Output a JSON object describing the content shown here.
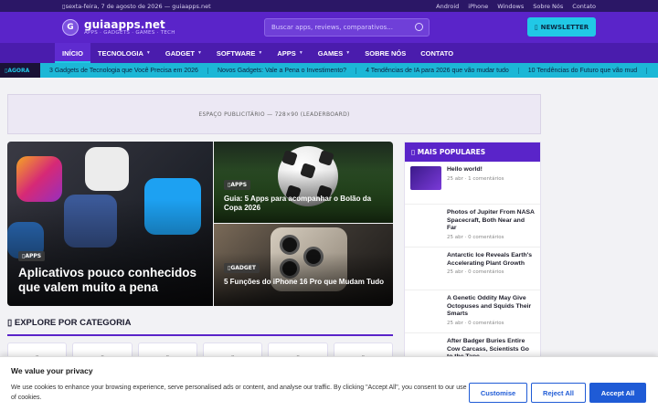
{
  "topbar": {
    "date": "sexta-feira, 7 de agosto de 2026 — guiaapps.net",
    "links": [
      "Android",
      "iPhone",
      "Windows",
      "Sobre Nós",
      "Contato"
    ]
  },
  "header": {
    "logo_letter": "G",
    "site_name": "guiaapps.net",
    "tagline": "APPS · GADGETS · GAMES · TECH",
    "search_placeholder": "Buscar apps, reviews, comparativos...",
    "newsletter_label": "NEWSLETTER"
  },
  "nav": [
    {
      "label": "INÍCIO",
      "active": true,
      "dropdown": false
    },
    {
      "label": "TECNOLOGIA",
      "active": false,
      "dropdown": true
    },
    {
      "label": "GADGET",
      "active": false,
      "dropdown": true
    },
    {
      "label": "SOFTWARE",
      "active": false,
      "dropdown": true
    },
    {
      "label": "APPS",
      "active": false,
      "dropdown": true
    },
    {
      "label": "GAMES",
      "active": false,
      "dropdown": true
    },
    {
      "label": "SOBRE NÓS",
      "active": false,
      "dropdown": false
    },
    {
      "label": "CONTATO",
      "active": false,
      "dropdown": false
    }
  ],
  "ticker": {
    "label": "AGORA",
    "items": [
      "3 Gadgets de Tecnologia que Você Precisa em 2026",
      "Novos Gadgets: Vale a Pena o Investimento?",
      "4 Tendências de IA para 2026 que vão mudar tudo",
      "10 Tendências do Futuro que vão mud"
    ]
  },
  "ad": {
    "label": "ESPAÇO PUBLICITÁRIO — 728×90 (LEADERBOARD)"
  },
  "hero": {
    "main": {
      "badge": "APPS",
      "title": "Aplicativos pouco conhecidos que valem muito a pena"
    },
    "top_right": {
      "badge": "APPS",
      "title": "Guia: 5 Apps para acompanhar o Bolão da Copa 2026"
    },
    "bottom_right": {
      "badge": "GADGET",
      "title": "5 Funções do iPhone 16 Pro que Mudam Tudo"
    }
  },
  "section": {
    "explore_title": "EXPLORE POR CATEGORIA"
  },
  "sidebar": {
    "title": "MAIS POPULARES",
    "items": [
      {
        "title": "Hello world!",
        "meta": "25 abr · 1 comentários"
      },
      {
        "title": "Photos of Jupiter From NASA Spacecraft, Both Near and Far",
        "meta": "25 abr · 0 comentários"
      },
      {
        "title": "Antarctic Ice Reveals Earth's Accelerating Plant Growth",
        "meta": "25 abr · 0 comentários"
      },
      {
        "title": "A Genetic Oddity May Give Octopuses and Squids Their Smarts",
        "meta": "25 abr · 0 comentários"
      },
      {
        "title": "After Badger Buries Entire Cow Carcass, Scientists Go to the Tape",
        "meta": ""
      }
    ]
  },
  "cookie": {
    "title": "We value your privacy",
    "text": "We use cookies to enhance your browsing experience, serve personalised ads or content, and analyse our traffic. By clicking \"Accept All\", you consent to our use of cookies.",
    "customise": "Customise",
    "reject": "Reject All",
    "accept": "Accept All"
  },
  "colors": {
    "primary": "#5a24c9",
    "accent": "#21c8e6",
    "button": "#1f5bd6"
  }
}
